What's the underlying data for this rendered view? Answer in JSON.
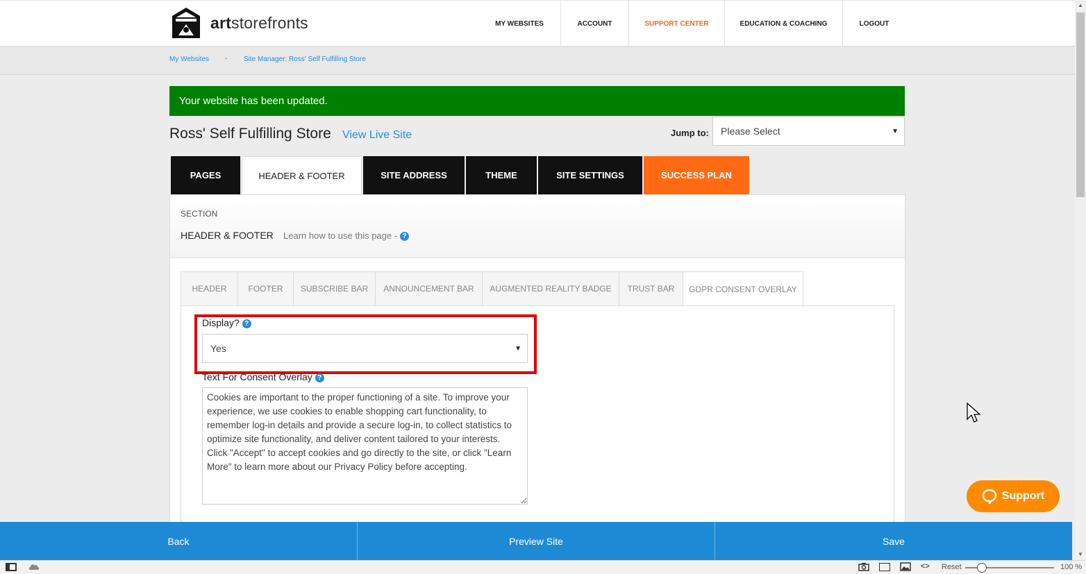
{
  "brand": {
    "name_bold": "art",
    "name_rest": "storefronts"
  },
  "nav": [
    {
      "label": "MY WEBSITES"
    },
    {
      "label": "ACCOUNT"
    },
    {
      "label": "SUPPORT CENTER"
    },
    {
      "label": "EDUCATION & COACHING"
    },
    {
      "label": "LOGOUT"
    }
  ],
  "breadcrumb": {
    "first": "My Websites",
    "separator": "-",
    "second": "Site Manager: Ross' Self Fulfilling Store"
  },
  "alert": {
    "message": "Your website has been updated.",
    "color": "#008000"
  },
  "store": {
    "title": "Ross' Self Fulfilling Store",
    "view_live": "View Live Site"
  },
  "jump": {
    "label": "Jump to:",
    "value": "Please Select"
  },
  "tabs": [
    {
      "label": "PAGES"
    },
    {
      "label": "HEADER & FOOTER"
    },
    {
      "label": "SITE ADDRESS"
    },
    {
      "label": "THEME"
    },
    {
      "label": "SITE SETTINGS"
    },
    {
      "label": "SUCCESS PLAN"
    }
  ],
  "section": {
    "label": "SECTION",
    "title": "HEADER & FOOTER",
    "learn": "Learn how to use this page -"
  },
  "subtabs": [
    {
      "label": "HEADER"
    },
    {
      "label": "FOOTER"
    },
    {
      "label": "SUBSCRIBE BAR"
    },
    {
      "label": "ANNOUNCEMENT BAR"
    },
    {
      "label": "AUGMENTED REALITY BADGE"
    },
    {
      "label": "TRUST BAR"
    },
    {
      "label": "GDPR CONSENT OVERLAY"
    }
  ],
  "form": {
    "display_label": "Display?",
    "display_value": "Yes",
    "consent_label": "Text For Consent Overlay",
    "consent_text": "Cookies are important to the proper functioning of a site. To improve your experience, we use cookies to enable shopping cart functionality, to remember log-in details and provide a secure log-in, to collect statistics to optimize site functionality, and deliver content tailored to your interests. Click \"Accept\" to accept cookies and go directly to the site, or click \"Learn More\" to learn more about our Privacy Policy before accepting."
  },
  "support_button": "Support",
  "bottom": {
    "back": "Back",
    "preview": "Preview Site",
    "save": "Save"
  },
  "status": {
    "reset": "Reset",
    "zoom": "100 %"
  },
  "colors": {
    "accent": "#1e8ad6",
    "orange": "#ff6a13",
    "support_orange": "#ff8a00",
    "highlight": "#e00000"
  }
}
